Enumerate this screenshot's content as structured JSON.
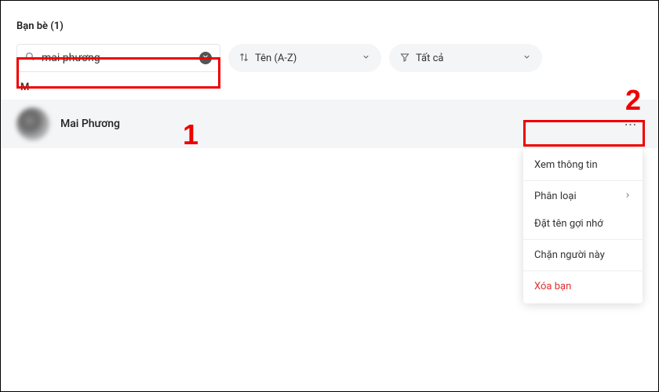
{
  "header": {
    "title": "Bạn bè (1)"
  },
  "search": {
    "value": "mai phương",
    "icon_name": "search"
  },
  "sort": {
    "label": "Tên (A-Z)"
  },
  "filter": {
    "label": "Tất cả"
  },
  "section_letter": "M",
  "friends": [
    {
      "name": "Mai Phương"
    }
  ],
  "context_menu": {
    "items": [
      {
        "label": "Xem thông tin",
        "type": "normal"
      },
      {
        "label": "Phân loại",
        "type": "submenu"
      },
      {
        "label": "Đặt tên gợi nhớ",
        "type": "normal"
      },
      {
        "label": "Chặn người này",
        "type": "normal"
      },
      {
        "label": "Xóa bạn",
        "type": "danger"
      }
    ]
  },
  "annotations": {
    "one": "1",
    "two": "2"
  }
}
